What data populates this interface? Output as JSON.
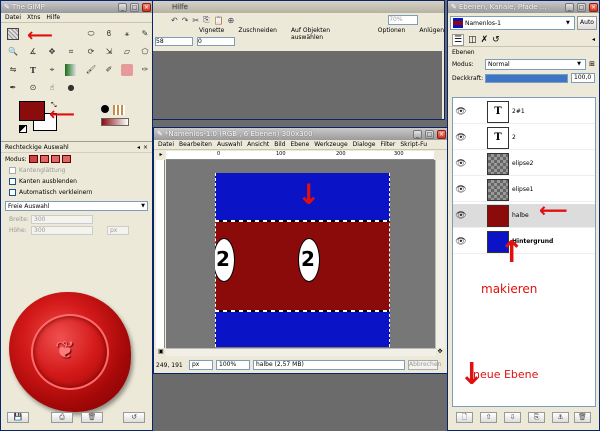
{
  "toolbox": {
    "title": "The GIMP",
    "menu": [
      "Datei",
      "Xtns",
      "Hilfe"
    ],
    "tool_options_title": "Rechteckige Auswahl",
    "mode_label": "Modus:",
    "antialias_label": "Kantenglättung",
    "feather_label": "Kanten ausblenden",
    "autoshrink_label": "Automatisch verkleinern",
    "selection_mode": "Freie Auswahl",
    "width_label": "Breite:",
    "width_value": "300",
    "height_label": "Höhe:",
    "height_value": "300",
    "unit": "px",
    "fg_color": "#8b0c0c",
    "bg_color": "#ffffff"
  },
  "bg_window": {
    "title": "Hilfe",
    "zoom": "70%",
    "tool_options": [
      "Vignette",
      "Zuschneiden",
      "Auf Objekten auswählen",
      "Optionen",
      "Anlügen"
    ],
    "field_a": "58",
    "field_b": "0"
  },
  "image_window": {
    "title": "*Namenlos-1.0 (RGB , 6 Ebenen) 300x300",
    "menu": [
      "Datei",
      "Bearbeiten",
      "Auswahl",
      "Ansicht",
      "Bild",
      "Ebene",
      "Werkzeuge",
      "Dialoge",
      "Filter",
      "Skript-Fu"
    ],
    "ruler_ticks": [
      "0",
      "100",
      "200",
      "300"
    ],
    "coords": "249, 191",
    "unit": "px",
    "zoom": "100%",
    "status": "halbe (2,57 MB)",
    "cancel_label": "Abbrechen",
    "blue": "#0b13c6",
    "red": "#8b0b0b",
    "ellipse_label_1": "2",
    "ellipse_label_2": "2"
  },
  "layers_dock": {
    "title": "Ebenen, Kanäle, Pfade ...",
    "image_select": "Namenlos-1",
    "auto_label": "Auto",
    "panel_title": "Ebenen",
    "mode_label": "Modus:",
    "mode_value": "Normal",
    "opacity_label": "Deckkraft:",
    "opacity_value": "100,0",
    "layers": [
      {
        "name": "2#1",
        "thumb": "text",
        "selected": false
      },
      {
        "name": "2",
        "thumb": "text",
        "selected": false
      },
      {
        "name": "elipse2",
        "thumb": "checker",
        "selected": false
      },
      {
        "name": "elipse1",
        "thumb": "checker",
        "selected": false
      },
      {
        "name": "halbe",
        "thumb": "red",
        "selected": true
      },
      {
        "name": "Hintergrund",
        "thumb": "blue",
        "selected": false
      }
    ]
  },
  "annotations": {
    "mark_text": "makieren",
    "new_layer_text": "neue Ebene"
  }
}
